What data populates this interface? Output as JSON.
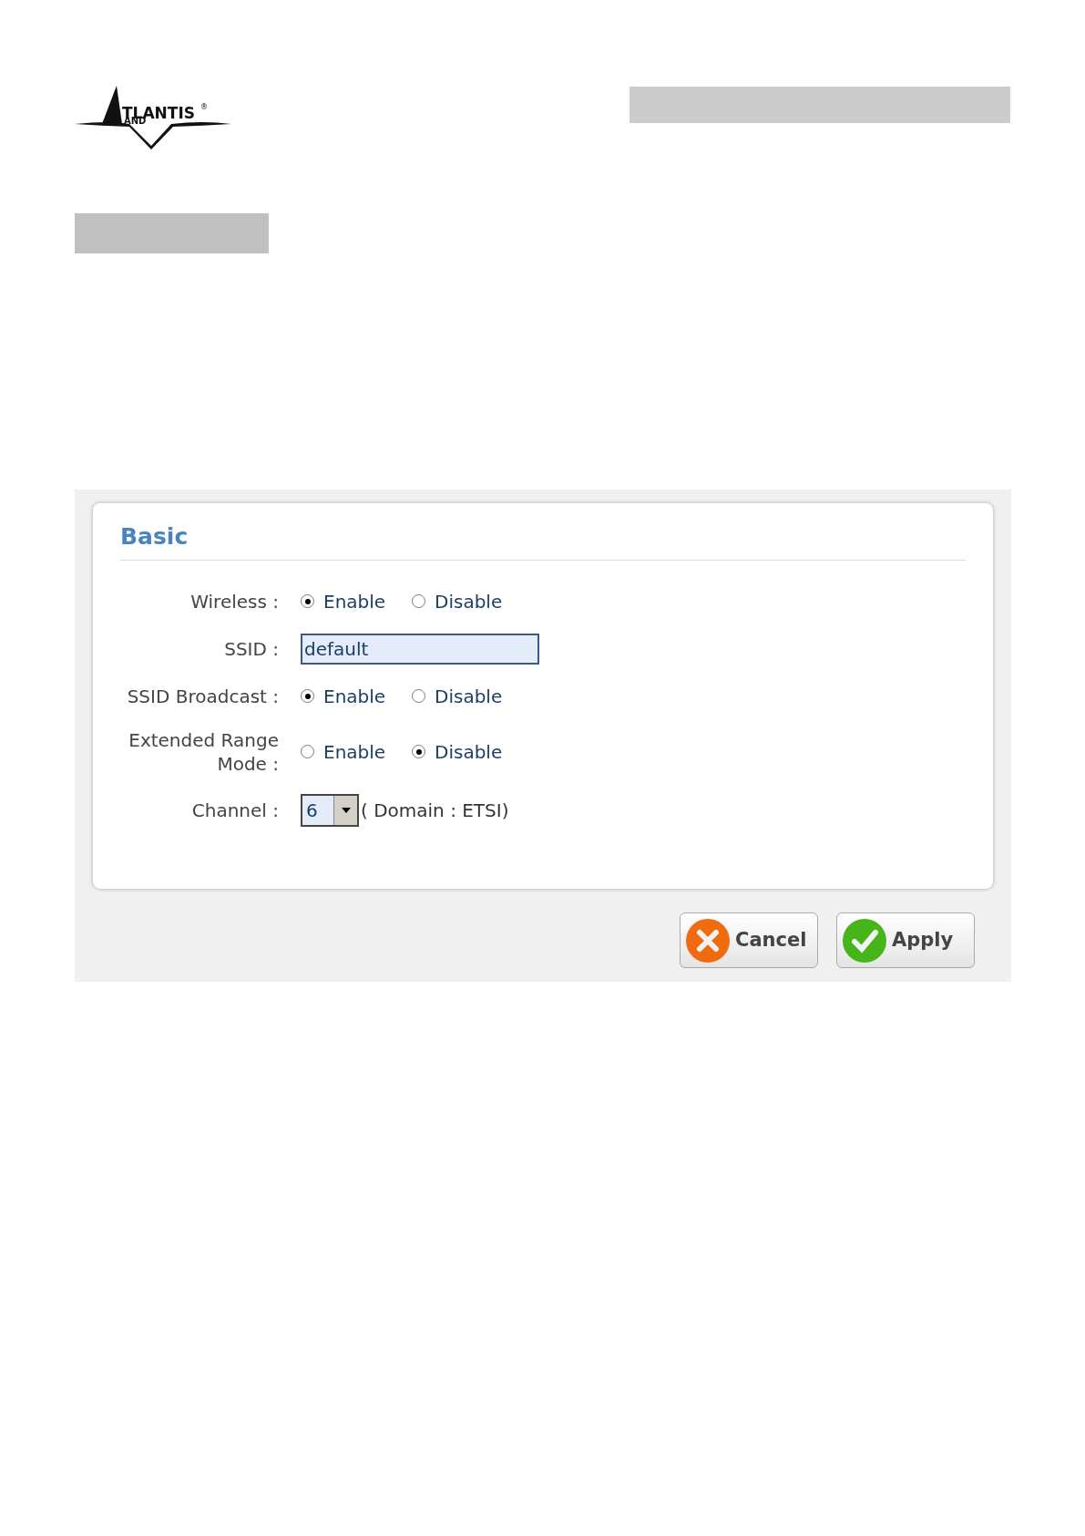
{
  "logo": {
    "text": "TLANTIS",
    "subtext": "AND",
    "mark": "®"
  },
  "panel": {
    "title": "Basic",
    "rows": [
      {
        "kind": "radio",
        "label": "Wireless :",
        "options": [
          {
            "label": "Enable",
            "selected": true
          },
          {
            "label": "Disable",
            "selected": false
          }
        ]
      },
      {
        "kind": "text",
        "label": "SSID :",
        "value": "default"
      },
      {
        "kind": "radio",
        "label": "SSID Broadcast :",
        "options": [
          {
            "label": "Enable",
            "selected": true
          },
          {
            "label": "Disable",
            "selected": false
          }
        ]
      },
      {
        "kind": "radio",
        "label": "Extended Range Mode :",
        "options": [
          {
            "label": "Enable",
            "selected": false
          },
          {
            "label": "Disable",
            "selected": true
          }
        ]
      },
      {
        "kind": "select",
        "label": "Channel :",
        "value": "6",
        "note": "( Domain : ETSI)"
      }
    ]
  },
  "buttons": [
    {
      "kind": "cancel",
      "label": "Cancel"
    },
    {
      "kind": "apply",
      "label": "Apply"
    }
  ]
}
